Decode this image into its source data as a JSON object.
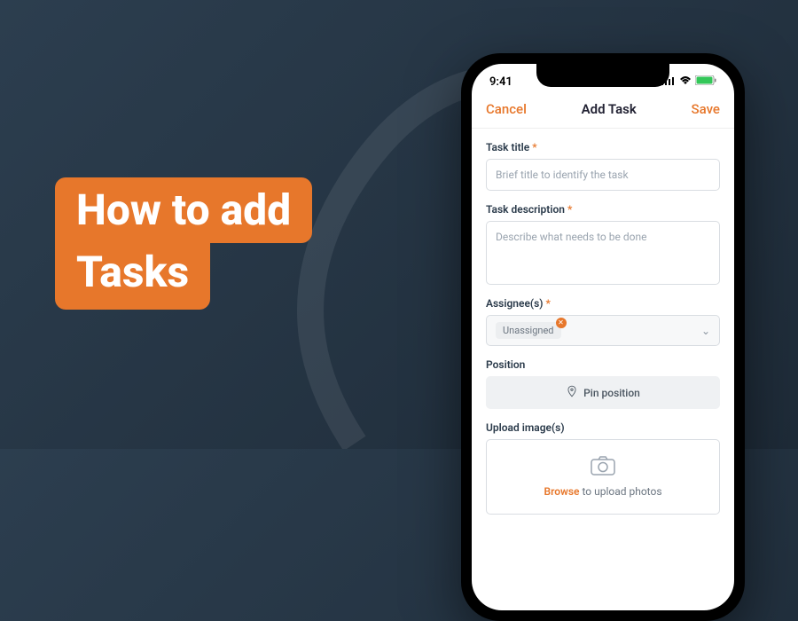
{
  "hero": {
    "line1": "How to add",
    "line2": "Tasks"
  },
  "statusbar": {
    "time": "9:41"
  },
  "nav": {
    "cancel": "Cancel",
    "title": "Add Task",
    "save": "Save"
  },
  "form": {
    "title_label": "Task title",
    "title_placeholder": "Brief title to identify the task",
    "desc_label": "Task description",
    "desc_placeholder": "Describe what needs to be done",
    "assignee_label": "Assignee(s)",
    "assignee_chip": "Unassigned",
    "position_label": "Position",
    "pin_button": "Pin position",
    "upload_label": "Upload image(s)",
    "upload_browse": "Browse",
    "upload_rest": " to upload photos"
  }
}
